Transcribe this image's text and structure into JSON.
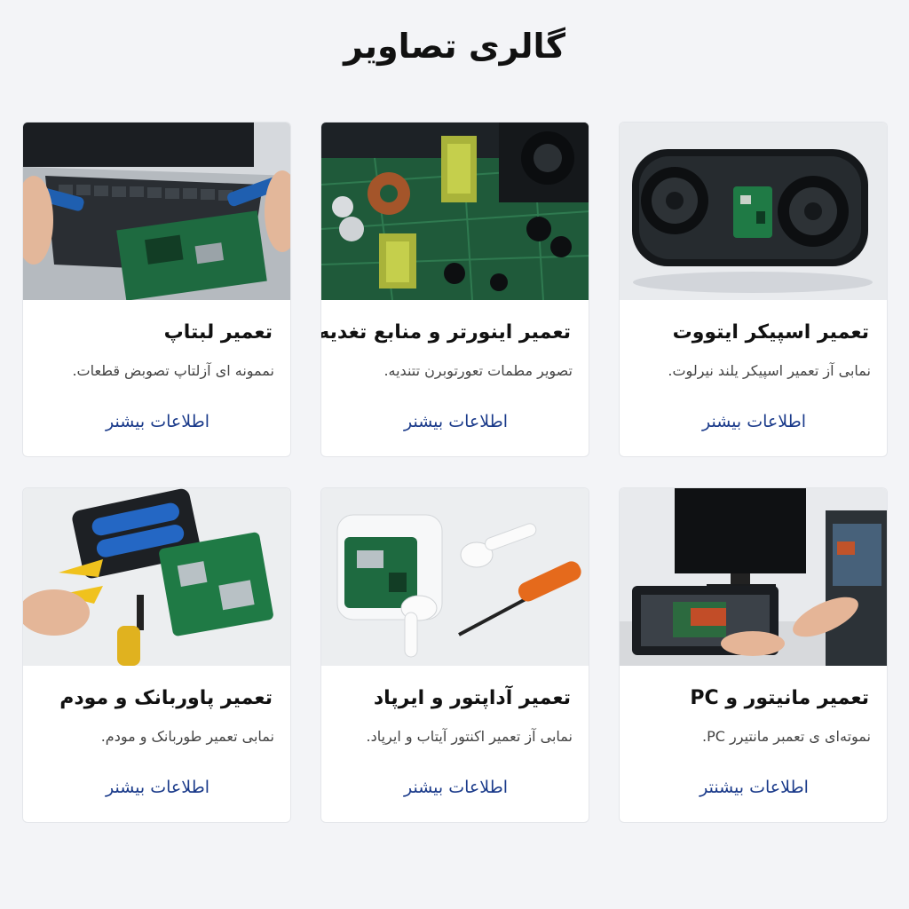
{
  "page": {
    "title": "گالری تصاویر"
  },
  "cards": [
    {
      "title": "تعمیر اسپیکر ایتووت",
      "description": "نمابی آز تعمیر اسپیکر یلند نیرلوت.",
      "link": "اطلاعات بیشنر",
      "image": "bluetooth-speaker-image"
    },
    {
      "title": "تعمیر اینورتر و منابع تغدیه",
      "description": "تصویر مطمات تعورتوبرن تتندیه.",
      "link": "اطلاعات بیشنر",
      "image": "power-supply-board-image"
    },
    {
      "title": "تعمیر لبتاپ",
      "description": "نممونه ای آزلتاپ تصوبض قطعات.",
      "link": "اطلاعات بیشنر",
      "image": "laptop-repair-image"
    },
    {
      "title": "تعمیر مانیتور و PC",
      "description": "نموته‌ای ی تعمبر مانتیرر PC.",
      "link": "اطلاعات بیشنتر",
      "image": "monitor-pc-repair-image"
    },
    {
      "title": "تعمیر  آداپتور و ایرپاد",
      "description": "نمابی آز تعمیر اکنتور آیتاب و ایرپاد.",
      "link": "اطلاعات بیشنر",
      "image": "adapter-airpods-image"
    },
    {
      "title": "تعمیر پاوربانک و مودم",
      "description": "نمابی تعمیر طوربانک و مودم.",
      "link": "اطلاعات بیشنر",
      "image": "powerbank-modem-image"
    }
  ]
}
